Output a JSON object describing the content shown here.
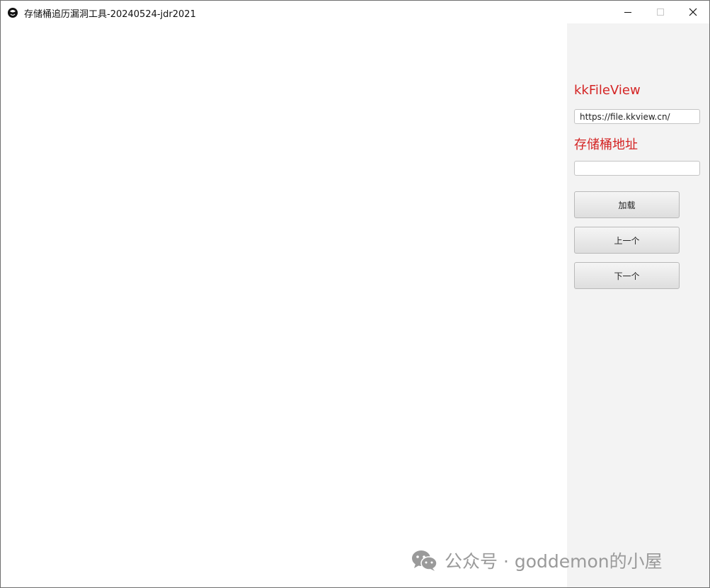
{
  "window": {
    "title": "存储桶追历漏洞工具-20240524-jdr2021"
  },
  "sidebar": {
    "kkfileview_label": "kkFileView",
    "kkfileview_value": "https://file.kkview.cn/",
    "bucket_label": "存储桶地址",
    "bucket_value": "",
    "load_button": "加载",
    "prev_button": "上一个",
    "next_button": "下一个"
  },
  "watermark": {
    "text": "公众号 · goddemon的小屋"
  },
  "colors": {
    "label_red": "#d42424",
    "panel_bg": "#f3f3f3"
  },
  "icons": {
    "app": "app-logo-icon",
    "minimize": "minimize-icon",
    "maximize": "maximize-icon",
    "close": "close-icon",
    "wechat": "wechat-icon"
  }
}
